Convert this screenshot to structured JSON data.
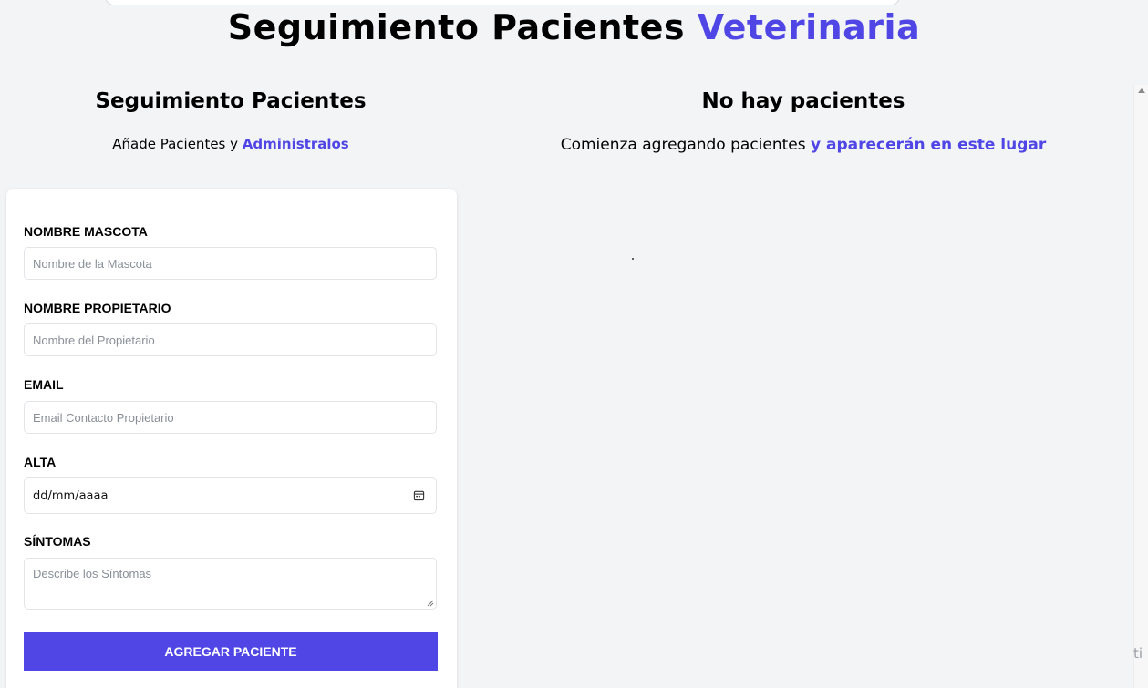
{
  "header": {
    "title_main": "Seguimiento Pacientes",
    "title_accent": "Veterinaria"
  },
  "form_section": {
    "title": "Seguimiento Pacientes",
    "subtitle_plain": "Añade Pacientes y",
    "subtitle_accent": "Administralos"
  },
  "list_section": {
    "title": "No hay pacientes",
    "subtitle_plain": "Comienza agregando pacientes",
    "subtitle_accent": "y aparecerán en este lugar"
  },
  "form": {
    "pet_name": {
      "label": "NOMBRE MASCOTA",
      "placeholder": "Nombre de la Mascota",
      "value": ""
    },
    "owner_name": {
      "label": "NOMBRE PROPIETARIO",
      "placeholder": "Nombre del Propietario",
      "value": ""
    },
    "email": {
      "label": "EMAIL",
      "placeholder": "Email Contacto Propietario",
      "value": ""
    },
    "discharge": {
      "label": "ALTA",
      "value": "dd/mm/aaaa",
      "icon": "calendar-icon"
    },
    "symptoms": {
      "label": "SÍNTOMAS",
      "placeholder": "Describe los Síntomas",
      "value": ""
    },
    "submit_label": "AGREGAR PACIENTE"
  },
  "edge_text": "ti",
  "colors": {
    "accent": "#4f46e5",
    "background": "#f3f4f6",
    "card": "#ffffff"
  }
}
